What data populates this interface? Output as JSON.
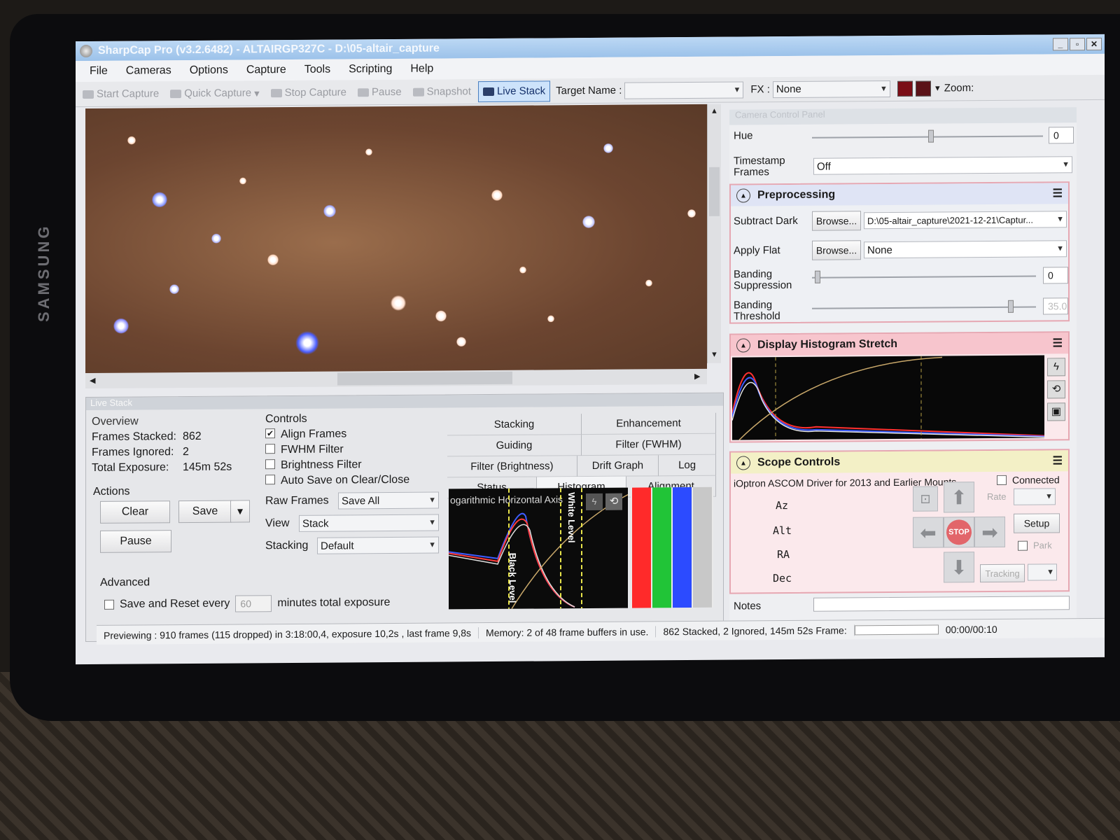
{
  "device": {
    "brand": "SAMSUNG"
  },
  "window": {
    "title": "SharpCap Pro (v3.2.6482) - ALTAIRGP327C - D:\\05-altair_capture",
    "min": "_",
    "max": "▫",
    "close": "✕"
  },
  "menu": [
    "File",
    "Cameras",
    "Options",
    "Capture",
    "Tools",
    "Scripting",
    "Help"
  ],
  "toolbar": {
    "start_capture": "Start Capture",
    "quick_capture": "Quick Capture",
    "stop_capture": "Stop Capture",
    "pause": "Pause",
    "snapshot": "Snapshot",
    "live_stack": "Live Stack",
    "target_name_label": "Target Name :",
    "target_name_value": "",
    "fx_label": "FX :",
    "fx_value": "None",
    "zoom_label": "Zoom:"
  },
  "live_stack": {
    "panel_title": "Live Stack",
    "overview": {
      "legend": "Overview",
      "frames_stacked_label": "Frames Stacked:",
      "frames_stacked": "862",
      "frames_ignored_label": "Frames Ignored:",
      "frames_ignored": "2",
      "total_exposure_label": "Total Exposure:",
      "total_exposure": "145m 52s"
    },
    "actions": {
      "legend": "Actions",
      "clear": "Clear",
      "save": "Save",
      "pause": "Pause"
    },
    "advanced": {
      "legend": "Advanced",
      "save_reset_label": "Save and Reset every",
      "minutes_value": "60",
      "minutes_label": "minutes total exposure"
    },
    "controls": {
      "legend": "Controls",
      "align_frames": "Align Frames",
      "align_checked": "✔",
      "fwhm_filter": "FWHM Filter",
      "brightness_filter": "Brightness Filter",
      "auto_save": "Auto Save on Clear/Close",
      "raw_frames_label": "Raw Frames",
      "raw_frames_value": "Save All",
      "view_label": "View",
      "view_value": "Stack",
      "stacking_label": "Stacking",
      "stacking_value": "Default"
    },
    "tabs": {
      "row1": [
        "Stacking",
        "Enhancement"
      ],
      "row2": [
        "Guiding",
        "Filter (FWHM)"
      ],
      "row3": [
        "Filter (Brightness)",
        "Drift Graph",
        "Log"
      ],
      "row4": [
        "Status",
        "Histogram",
        "Alignment"
      ]
    },
    "histogram": {
      "axis_label": "ogarithmic Horizontal Axis",
      "black_level": "Black Level",
      "white_level": "White Level"
    }
  },
  "status": {
    "previewing": "Previewing : 910 frames (115 dropped) in 3:18:00,4, exposure 10,2s , last frame 9,8s",
    "memory": "Memory: 2 of 48 frame buffers in use.",
    "stacked": "862 Stacked, 2 Ignored, 145m 52s Frame:",
    "time": "00:00/00:10"
  },
  "camera_panel": {
    "title": "Camera Control Panel",
    "hue_label": "Hue",
    "hue_value": "0",
    "timestamp_label": "Timestamp Frames",
    "timestamp_value": "Off",
    "preprocessing": {
      "title": "Preprocessing",
      "subtract_dark_label": "Subtract Dark",
      "browse": "Browse...",
      "subtract_dark_value": "D:\\05-altair_capture\\2021-12-21\\Captur...",
      "apply_flat_label": "Apply Flat",
      "apply_flat_value": "None",
      "banding_suppression_label": "Banding Suppression",
      "banding_suppression_value": "0",
      "banding_threshold_label": "Banding Threshold",
      "banding_threshold_value": "35.0"
    },
    "histogram_stretch": {
      "title": "Display Histogram Stretch"
    },
    "scope": {
      "title": "Scope Controls",
      "driver": "iOptron ASCOM Driver for 2013 and Earlier Mounts",
      "connected": "Connected",
      "az": "Az",
      "alt": "Alt",
      "ra": "RA",
      "dec": "Dec",
      "rate": "Rate",
      "setup": "Setup",
      "park": "Park",
      "tracking": "Tracking",
      "stop": "STOP"
    },
    "notes_label": "Notes"
  },
  "colors": {
    "accent": "#4a7fc0",
    "section_border": "#e6a7b2",
    "stop": "#e2656a"
  }
}
